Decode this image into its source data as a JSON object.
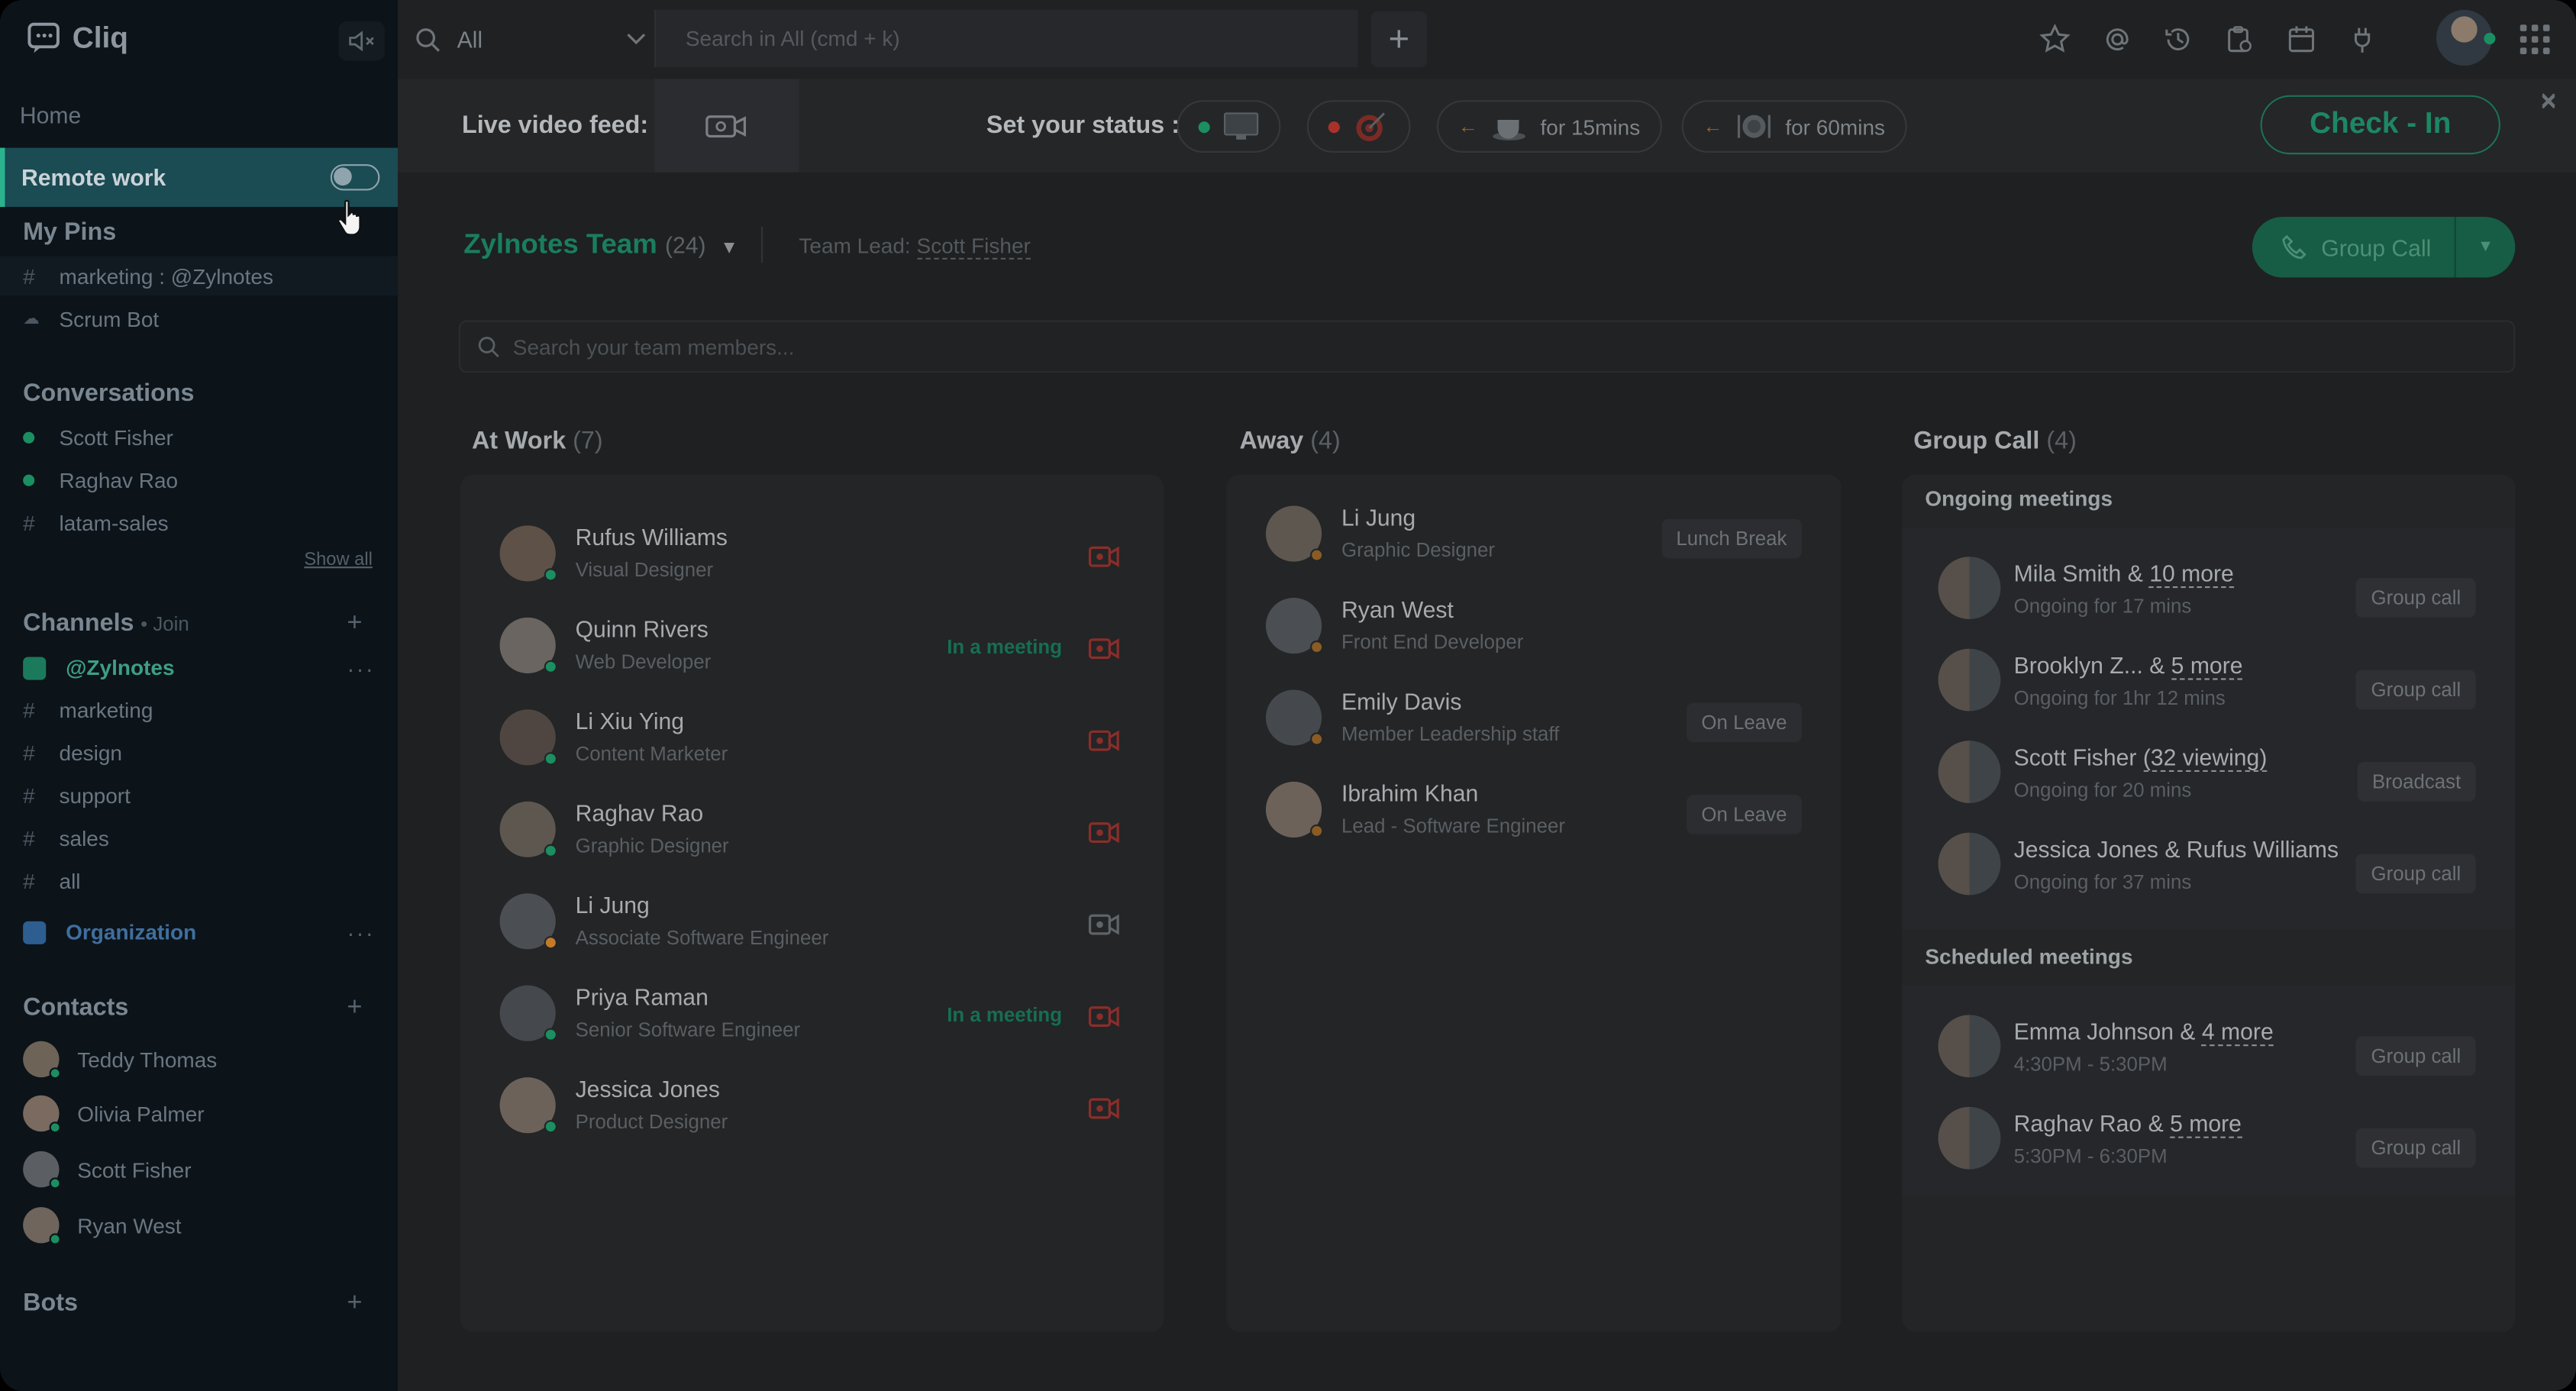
{
  "app": {
    "name": "Cliq"
  },
  "sidebar": {
    "home": "Home",
    "remote_work": "Remote work",
    "my_pins": {
      "title": "My Pins",
      "items": [
        {
          "prefix": "#",
          "label": "marketing : @Zylnotes"
        },
        {
          "prefix": "bot",
          "label": "Scrum Bot"
        }
      ]
    },
    "conversations": {
      "title": "Conversations",
      "items": [
        {
          "prefix": "dot",
          "label": "Scott Fisher"
        },
        {
          "prefix": "dot",
          "label": "Raghav Rao"
        },
        {
          "prefix": "#",
          "label": "latam-sales"
        }
      ],
      "show_all": "Show all"
    },
    "channels": {
      "title": "Channels",
      "join": "• Join",
      "items": [
        {
          "prefix": "org",
          "label": "@Zylnotes",
          "highlight": true
        },
        {
          "prefix": "#",
          "label": "marketing"
        },
        {
          "prefix": "#",
          "label": "design"
        },
        {
          "prefix": "#",
          "label": "support"
        },
        {
          "prefix": "#",
          "label": "sales"
        },
        {
          "prefix": "#",
          "label": "all"
        },
        {
          "prefix": "org",
          "label": "Organization",
          "highlight": true
        }
      ]
    },
    "contacts": {
      "title": "Contacts",
      "items": [
        {
          "label": "Teddy Thomas"
        },
        {
          "label": "Olivia Palmer"
        },
        {
          "label": "Scott Fisher"
        },
        {
          "label": "Ryan West"
        }
      ]
    },
    "bots": {
      "title": "Bots"
    }
  },
  "topbar": {
    "filter": "All",
    "search_placeholder": "Search in All (cmd + k)",
    "add": "+",
    "icons": [
      "star-icon",
      "mention-icon",
      "history-icon",
      "clipboard-icon",
      "calendar-icon",
      "settings-icon"
    ]
  },
  "statusbar": {
    "live_video_feed": "Live video feed:",
    "set_your_status": "Set your status :",
    "chips": [
      {
        "dot_color": "#1b8f61",
        "icon": "monitor-icon",
        "text": ""
      },
      {
        "dot_color": "#c0392b",
        "icon": "target-icon",
        "text": ""
      },
      {
        "dot_color": "#c57a2a",
        "icon": "coffee-icon",
        "text": "for 15mins"
      },
      {
        "dot_color": "#c57a2a",
        "icon": "lunch-icon",
        "text": "for 60mins"
      }
    ],
    "check_in": "Check - In",
    "close": "×"
  },
  "team": {
    "name": "Zylnotes Team",
    "count": "(24)",
    "lead_label": "Team Lead:",
    "lead_name": "Scott Fisher",
    "group_call": "Group Call",
    "search_placeholder": "Search your team members..."
  },
  "at_work": {
    "title": "At Work",
    "count": "(7)",
    "members": [
      {
        "name": "Rufus Williams",
        "role": "Visual Designer",
        "status": "",
        "presence": "#1b8f61",
        "cam_active": true
      },
      {
        "name": "Quinn Rivers",
        "role": "Web Developer",
        "status": "In a meeting",
        "presence": "#1b8f61",
        "cam_active": true
      },
      {
        "name": "Li Xiu Ying",
        "role": "Content Marketer",
        "status": "",
        "presence": "#1b8f61",
        "cam_active": true
      },
      {
        "name": "Raghav Rao",
        "role": "Graphic Designer",
        "status": "",
        "presence": "#1b8f61",
        "cam_active": true
      },
      {
        "name": "Li Jung",
        "role": "Associate Software Engineer",
        "status": "",
        "presence": "#c57a2a",
        "cam_active": false
      },
      {
        "name": "Priya Raman",
        "role": "Senior Software Engineer",
        "status": "In a meeting",
        "presence": "#1b8f61",
        "cam_active": true
      },
      {
        "name": "Jessica Jones",
        "role": "Product Designer",
        "status": "",
        "presence": "#1b8f61",
        "cam_active": true
      }
    ]
  },
  "away": {
    "title": "Away",
    "count": "(4)",
    "members": [
      {
        "name": "Li Jung",
        "role": "Graphic Designer",
        "tag": "Lunch Break"
      },
      {
        "name": "Ryan West",
        "role": "Front End Developer",
        "tag": ""
      },
      {
        "name": "Emily Davis",
        "role": "Member Leadership staff",
        "tag": "On Leave"
      },
      {
        "name": "Ibrahim Khan",
        "role": "Lead - Software Engineer",
        "tag": "On Leave"
      }
    ]
  },
  "group_call": {
    "title": "Group Call",
    "count": "(4)",
    "ongoing_title": "Ongoing meetings",
    "ongoing": [
      {
        "name_a": "Mila Smith & ",
        "name_b": "10 more",
        "sub": "Ongoing for 17 mins",
        "action": "Group call"
      },
      {
        "name_a": "Brooklyn Z... & ",
        "name_b": "5 more",
        "sub": "Ongoing for 1hr 12 mins",
        "action": "Group call"
      },
      {
        "name_a": "Scott Fisher ",
        "name_b": "(32 viewing)",
        "sub": "Ongoing for 20 mins",
        "action": "Broadcast"
      },
      {
        "name_a": "Jessica Jones & Rufus Williams",
        "name_b": "",
        "sub": "Ongoing for 37 mins",
        "action": "Group call"
      }
    ],
    "scheduled_title": "Scheduled meetings",
    "scheduled": [
      {
        "name_a": "Emma Johnson & ",
        "name_b": "4 more",
        "sub": "4:30PM - 5:30PM",
        "action": "Group call"
      },
      {
        "name_a": "Raghav Rao & ",
        "name_b": "5 more",
        "sub": "5:30PM - 6:30PM",
        "action": "Group call"
      }
    ]
  }
}
